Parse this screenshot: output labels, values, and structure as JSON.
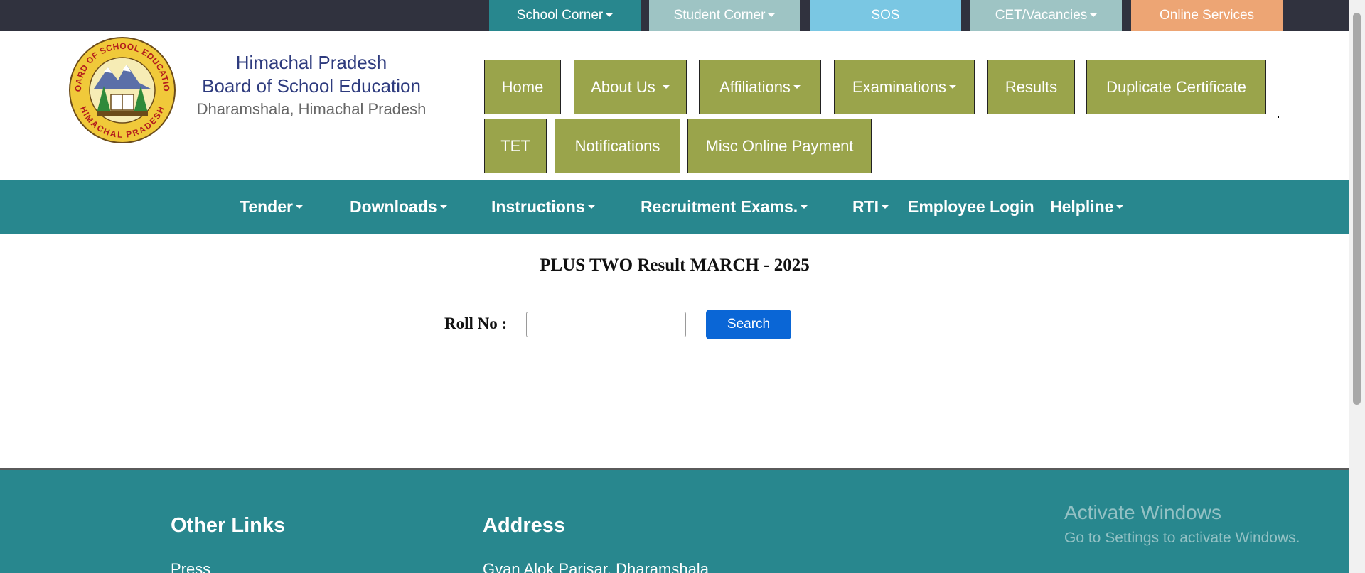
{
  "topbar": {
    "school_corner": "School Corner",
    "student_corner": "Student Corner",
    "sos": "SOS",
    "cet_vacancies": "CET/Vacancies",
    "online_services": "Online Services"
  },
  "brand": {
    "line1": "Himachal Pradesh",
    "line2": "Board of School Education",
    "line3": "Dharamshala, Himachal Pradesh",
    "logo_ring_top": "BOARD OF SCHOOL EDUCATION",
    "logo_ring_bottom": "HIMACHAL PRADESH"
  },
  "nav": {
    "home": "Home",
    "about": "About Us",
    "affiliations": "Affiliations",
    "examinations": "Examinations",
    "results": "Results",
    "duplicate": "Duplicate Certificate",
    "tet": "TET",
    "notifications": "Notifications",
    "misc_payment": "Misc Online Payment"
  },
  "menu": {
    "tender": "Tender",
    "downloads": "Downloads",
    "instructions": "Instructions",
    "recruitment": "Recruitment Exams.",
    "rti": "RTI",
    "employee_login": "Employee Login",
    "helpline": "Helpline"
  },
  "content": {
    "title": "PLUS TWO Result MARCH - 2025",
    "roll_label": "Roll No :",
    "roll_value": "",
    "search_label": "Search"
  },
  "footer": {
    "other_links": "Other Links",
    "address": "Address",
    "press": "Press",
    "address_line": "Gyan Alok Parisar, Dharamshala"
  },
  "watermark": {
    "line1": "Activate Windows",
    "line2": "Go to Settings to activate Windows."
  },
  "colors": {
    "topbar_bg": "#30323e",
    "school_corner": "#28878e",
    "student_corner": "#9ec4c4",
    "sos": "#7ac7e3",
    "cet": "#9ec4c4",
    "online_services": "#eda574",
    "nav_button": "#9aa44b",
    "teal": "#28878e",
    "search_button": "#0a66d6",
    "brand_text": "#2e3b7e"
  }
}
